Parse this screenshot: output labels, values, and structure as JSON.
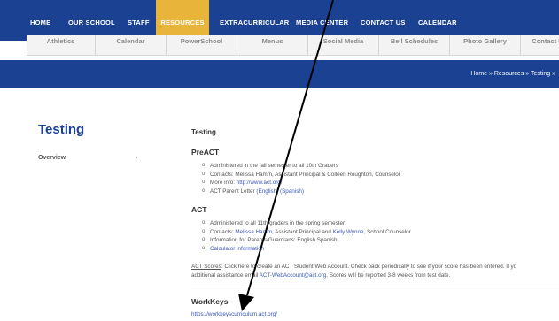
{
  "topnav": {
    "items": [
      "HOME",
      "OUR SCHOOL",
      "STAFF",
      "RESOURCES",
      "EXTRACURRICULAR",
      "MEDIA CENTER",
      "CONTACT US",
      "CALENDAR"
    ],
    "active": "RESOURCES",
    "colors": {
      "bar": "#1a4192",
      "active": "#e8b43a"
    }
  },
  "subnav": {
    "items": [
      "Athletics",
      "Calendar",
      "PowerSchool",
      "Menus",
      "Social Media",
      "Bell Schedules",
      "Photo Gallery",
      "Contact U"
    ]
  },
  "breadcrumb": "Home » Resources » Testing »",
  "page_title": "Testing",
  "sidebar": {
    "items": [
      {
        "label": "Overview",
        "chevron": "›"
      }
    ]
  },
  "content": {
    "heading": "Testing",
    "preact": {
      "title": "PreACT",
      "items": [
        {
          "text": "Administered in the fall semester to all 10th Graders"
        },
        {
          "text": "Contacts: Melissa Hamm, Assistant Principal & Colleen Roughton, Counselor"
        },
        {
          "prefix": "More info:  ",
          "link": "http://www.act.org/"
        },
        {
          "prefix": "ACT Parent Letter ",
          "link1": "(English)",
          "link2": " (Spanish)"
        }
      ]
    },
    "act": {
      "title": "ACT",
      "items": [
        {
          "text": "Administered to all 11th graders in the spring semester"
        },
        {
          "prefix": "Contacts: ",
          "link1": "Melissa Hamm",
          "mid": ", Assistant Principal and ",
          "link2": "Kelly Wynne",
          "suffix": ", School Counselor"
        },
        {
          "text": "Information for Parents/Guardians: English Spanish"
        },
        {
          "link": "Calculator information"
        }
      ]
    },
    "scores_para": {
      "lead": "ACT Scores",
      "line1": ": Click here to create an ACT Student Web Account. Check back periodically to see if your score has been entered. If yo",
      "line2_pre": "additional assistance email ",
      "line2_link": "ACT-WebAccount@act.org",
      "line2_post": ". Scores will be reported 3-8 weeks from test date."
    },
    "workkeys": {
      "title": "WorkKeys",
      "link": "https://workkeyscurriculum.act.org/"
    }
  },
  "icons": {
    "bullet": "o",
    "arrow": "annotation-arrow-icon"
  }
}
